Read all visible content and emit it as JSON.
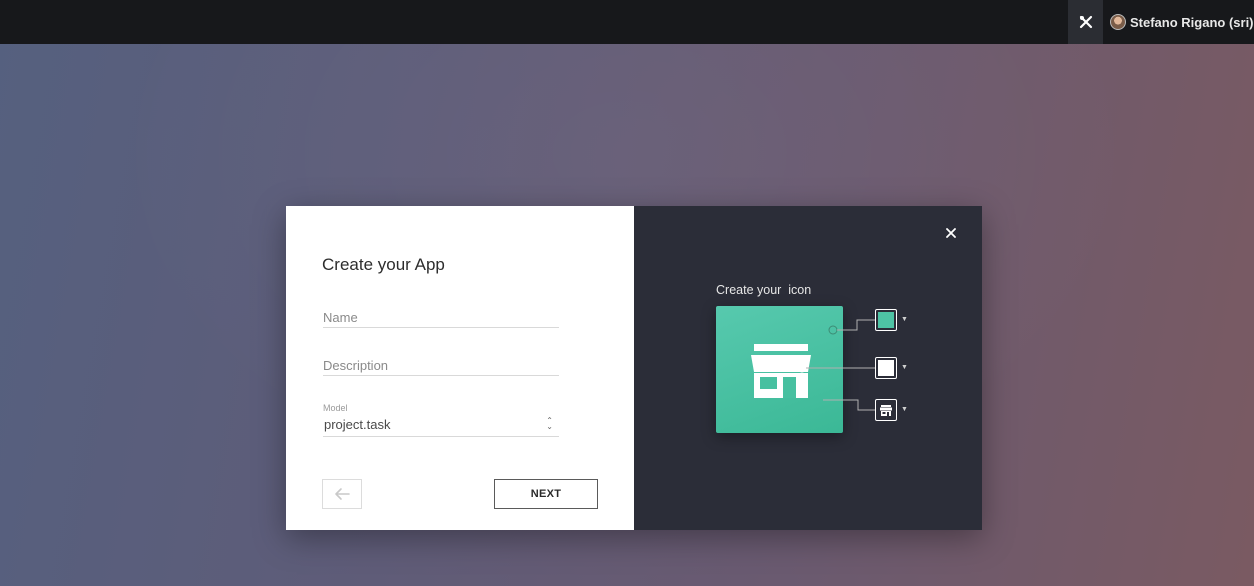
{
  "topbar": {
    "tools_icon": "tools-icon",
    "user_name": "Stefano Rigano (sri)"
  },
  "dialog": {
    "title": "Create your App",
    "fields": {
      "name_placeholder": "Name",
      "description_placeholder": "Description",
      "model_label": "Model",
      "model_value": "project.task"
    },
    "back_icon": "arrow-left-icon",
    "next_label": "NEXT",
    "icon_panel": {
      "title": "Create your  icon",
      "close_icon": "close-icon",
      "background_color": "#4ec4a5",
      "icon_color": "#ffffff",
      "selected_icon": "store-icon"
    }
  },
  "colors": {
    "topbar": "#17181b",
    "dark_panel": "#2b2d38",
    "accent": "#4ec4a5"
  }
}
